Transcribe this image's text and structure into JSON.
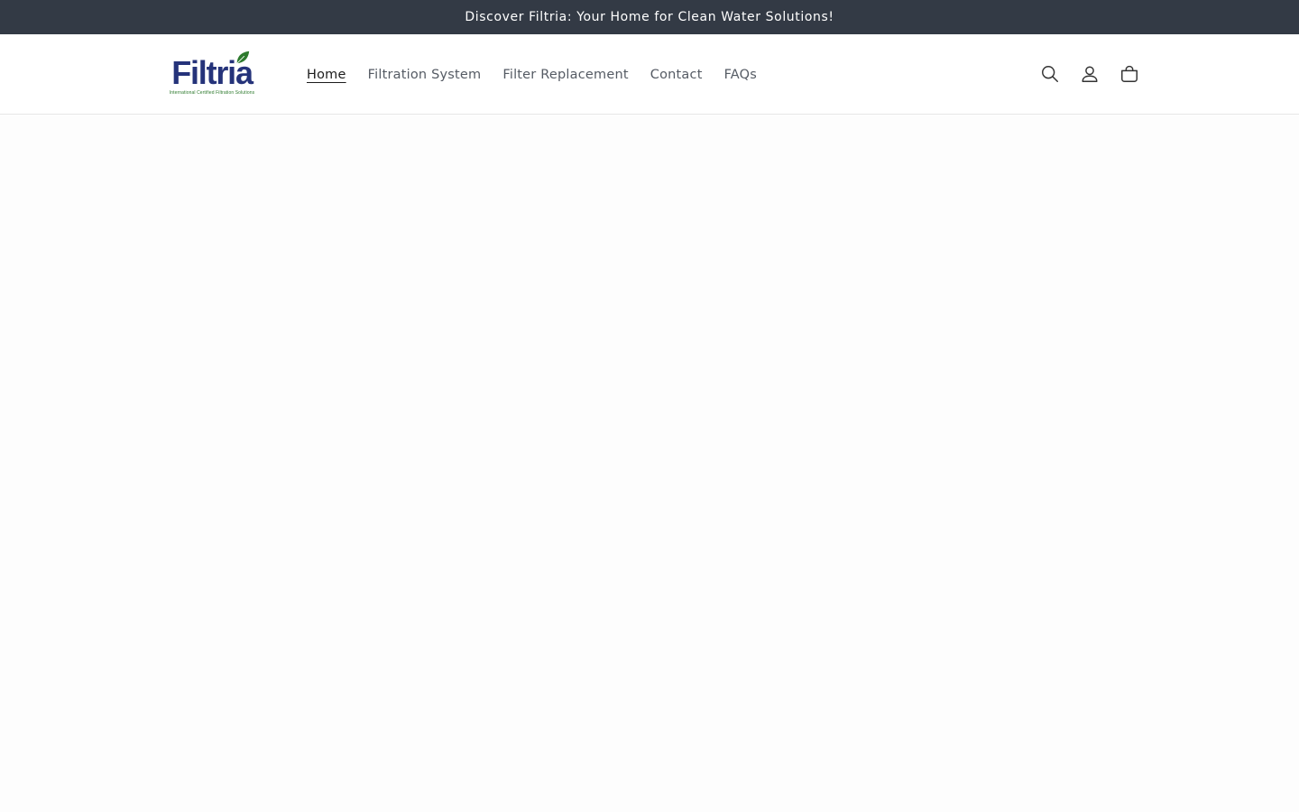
{
  "announcement": {
    "text": "Discover Filtria: Your Home for Clean Water Solutions!"
  },
  "logo": {
    "wordmark": "Filtria",
    "tagline": "International Certified Filtration Solutions",
    "brand_color": "#25337a",
    "leaf_color": "#2d7a2d"
  },
  "nav": {
    "items": [
      {
        "label": "Home",
        "active": true
      },
      {
        "label": "Filtration System",
        "active": false
      },
      {
        "label": "Filter Replacement",
        "active": false
      },
      {
        "label": "Contact",
        "active": false
      },
      {
        "label": "FAQs",
        "active": false
      }
    ]
  },
  "header_icons": {
    "search": "search-icon",
    "account": "account-icon",
    "cart": "cart-icon"
  },
  "colors": {
    "announcement_bg": "#333a45",
    "page_bg": "#fdfdfd"
  }
}
